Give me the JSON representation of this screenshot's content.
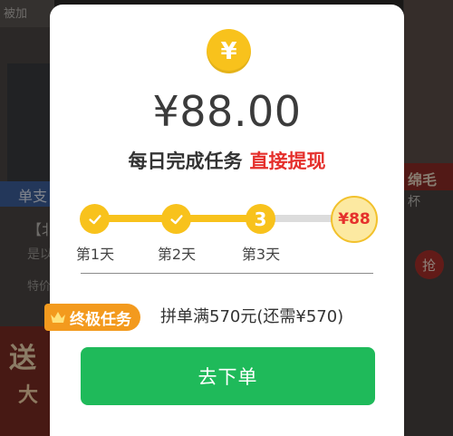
{
  "background": {
    "top_left_text": "被加",
    "left_text_1": "单支",
    "left_text_2": "【北",
    "left_text_3": "是以",
    "left_text_4": "特价",
    "left_promo_1": "送",
    "left_promo_2": "大",
    "right_text_1": "绵毛",
    "right_text_2": "杯",
    "right_badge": "抢"
  },
  "dialog": {
    "coin_symbol": "¥",
    "amount": "¥88.00",
    "subtitle_main": "每日完成任务",
    "subtitle_highlight": "直接提现",
    "steps": [
      {
        "label": "第1天",
        "state": "done"
      },
      {
        "label": "第2天",
        "state": "done"
      },
      {
        "label": "第3天",
        "number": "3",
        "state": "current"
      }
    ],
    "reward_label": "¥88",
    "final_task": {
      "badge": "终极任务",
      "text": "拼单满570元(还需¥570)"
    },
    "cta_label": "去下单"
  },
  "colors": {
    "accent_yellow": "#f8c21c",
    "highlight_red": "#e5302c",
    "badge_orange": "#f39a1e",
    "button_green": "#1fba5a"
  },
  "icons": [
    "yen-coin-icon",
    "check-icon",
    "crown-icon"
  ]
}
